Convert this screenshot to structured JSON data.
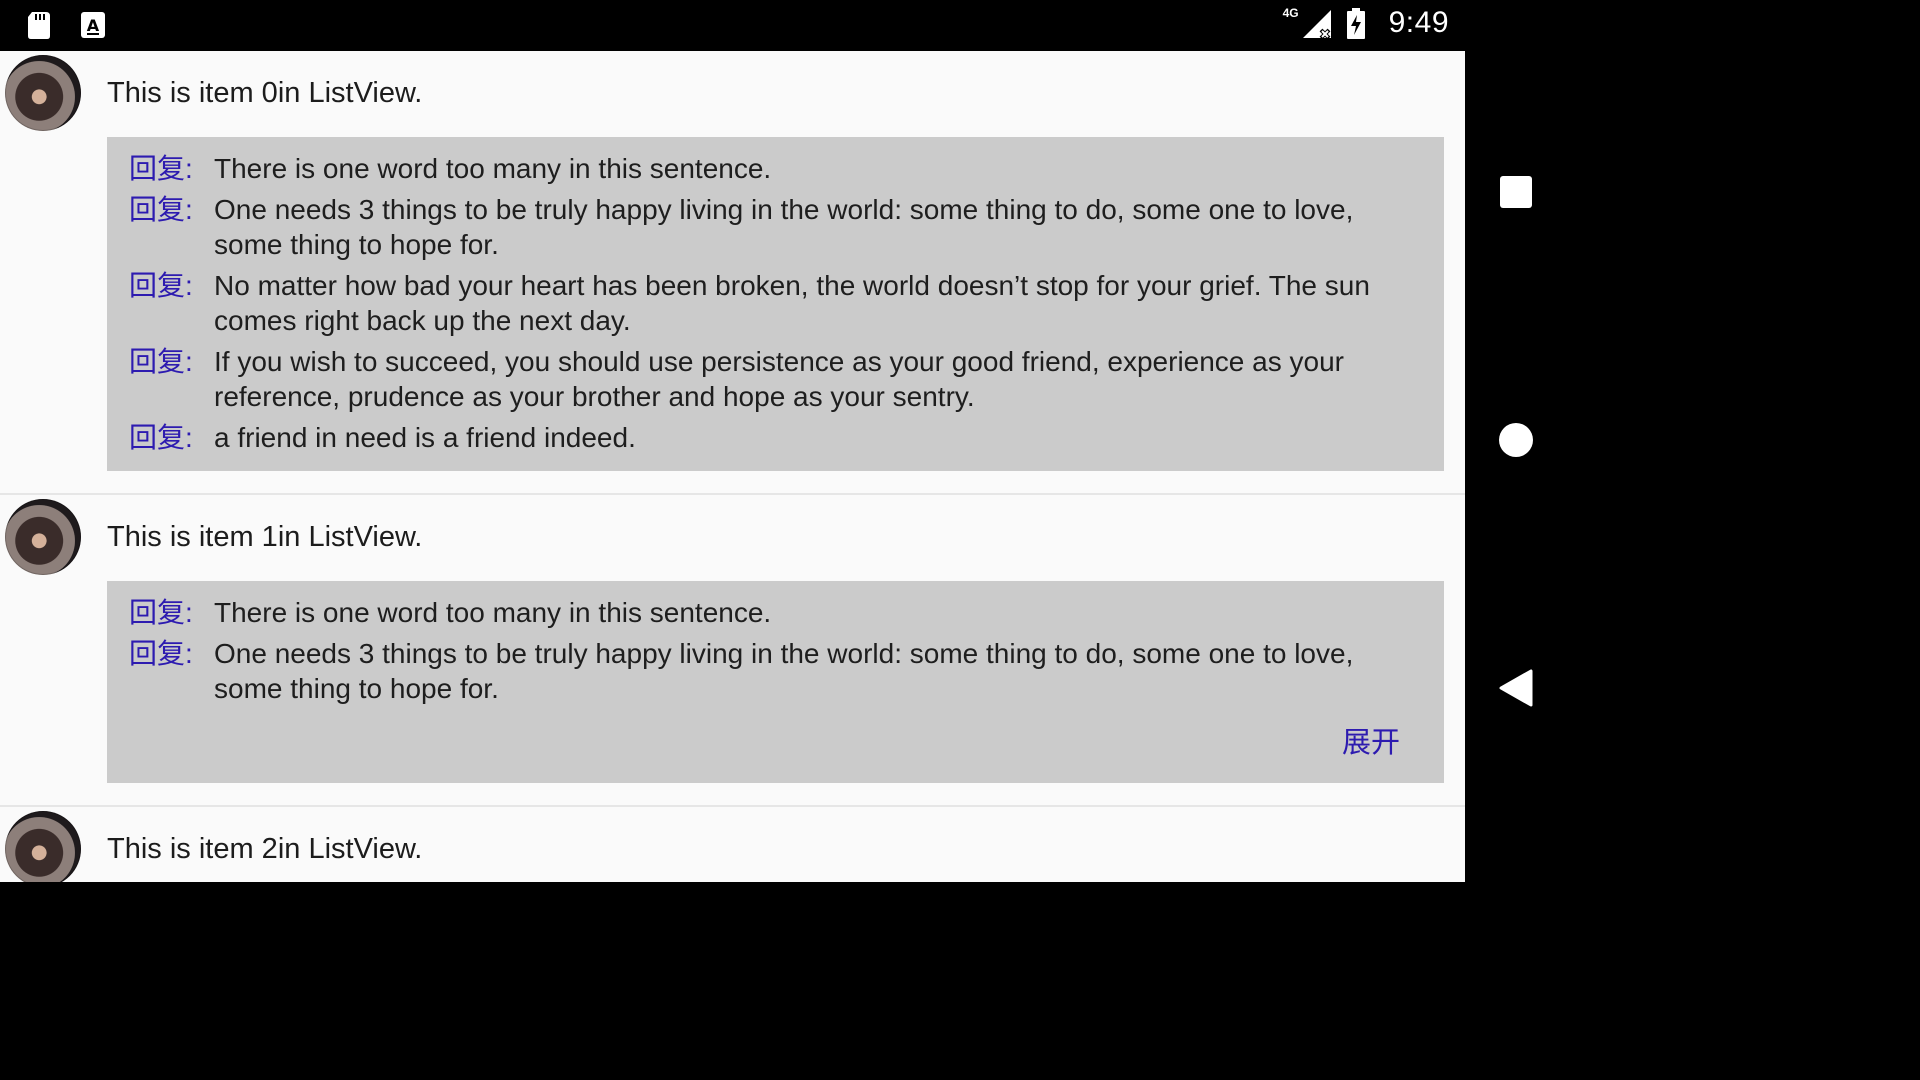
{
  "status_bar": {
    "time": "9:49",
    "network": "4G",
    "icons": [
      "sd-card-icon",
      "keyboard-a-icon",
      "signal-icon",
      "battery-charging-icon"
    ]
  },
  "list": {
    "items": [
      {
        "title": "This is item 0in ListView.",
        "replies": [
          {
            "label": "回复:",
            "text": "There is one word too many in this sentence."
          },
          {
            "label": "回复:",
            "text": "One needs 3 things to be truly happy living in the world: some thing to do, some one to love, some thing to hope for."
          },
          {
            "label": "回复:",
            "text": "No matter how bad your heart has been broken, the world doesn’t stop for your grief. The sun comes right back up the next day."
          },
          {
            "label": "回复:",
            "text": "If you wish to succeed, you should use persistence as your good friend, experience as your reference, prudence as your brother and hope as your sentry."
          },
          {
            "label": "回复:",
            "text": "a friend in need is a friend indeed."
          }
        ]
      },
      {
        "title": "This is item 1in ListView.",
        "replies": [
          {
            "label": "回复:",
            "text": "There is one word too many in this sentence."
          },
          {
            "label": "回复:",
            "text": "One needs 3 things to be truly happy living in the world: some thing to do, some one to love, some thing to hope for."
          }
        ],
        "expand_label": "展开"
      },
      {
        "title": "This is item 2in ListView."
      }
    ]
  },
  "navigation": {
    "buttons": [
      "recents-square-icon",
      "home-circle-icon",
      "back-triangle-icon"
    ]
  },
  "colors": {
    "reply_label": "#2d1bb0",
    "reply_box_bg": "#cbcbcb",
    "list_bg": "#fafafa"
  }
}
